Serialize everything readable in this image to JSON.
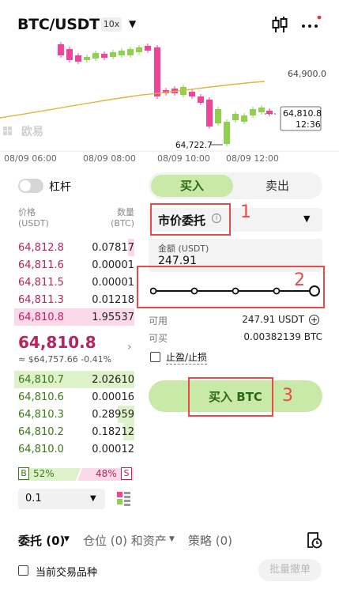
{
  "header": {
    "pair": "BTC/USDT",
    "leverage": "10x",
    "candle_icon": "candlestick-icon",
    "more_icon": "more-dots-icon"
  },
  "chart": {
    "watermark": "欧易",
    "price_labels": [
      "64,900.0",
      "64,810.8",
      "12:36"
    ],
    "low_marker": "64,722.7",
    "time_labels": [
      "08/09 06:00",
      "08/09 08:00",
      "08/09 10:00",
      "08/09 12:00"
    ],
    "colors": {
      "up": "#8fd14f",
      "down": "#f0449b",
      "ma": "#e2b53d"
    }
  },
  "trade": {
    "tab_buy": "买入",
    "tab_sell": "卖出",
    "order_type": "市价委托",
    "info_icon": "i",
    "amount_label": "金额 (USDT)",
    "amount_value": "247.91",
    "slider_percent": 100,
    "available_label": "可用",
    "available_value": "247.91 USDT",
    "canbuy_label": "可买",
    "canbuy_value": "0.00382139 BTC",
    "tpsl_label": "止盈/止损",
    "buy_button": "买入 BTC"
  },
  "orderbook": {
    "leverage_label": "杠杆",
    "price_header": "价格\n(USDT)",
    "qty_header": "数量\n(BTC)",
    "asks": [
      {
        "price": "64,812.8",
        "qty": "0.07817",
        "depth": 0.05
      },
      {
        "price": "64,811.6",
        "qty": "0.00001",
        "depth": 0.0
      },
      {
        "price": "64,811.5",
        "qty": "0.00001",
        "depth": 0.0
      },
      {
        "price": "64,811.3",
        "qty": "0.01218",
        "depth": 0.0
      },
      {
        "price": "64,810.8",
        "qty": "1.95537",
        "depth": 1.0
      }
    ],
    "last_price": "64,810.8",
    "last_sub": "≈ $64,757.66  -0.41%",
    "bids": [
      {
        "price": "64,810.7",
        "qty": "2.02610",
        "depth": 1.0
      },
      {
        "price": "64,810.6",
        "qty": "0.00016",
        "depth": 0.0
      },
      {
        "price": "64,810.3",
        "qty": "0.28959",
        "depth": 0.14
      },
      {
        "price": "64,810.2",
        "qty": "0.18212",
        "depth": 0.09
      },
      {
        "price": "64,810.0",
        "qty": "0.00012",
        "depth": 0.0
      }
    ],
    "buy_tag": "B",
    "buy_pct": "52%",
    "sell_pct": "48%",
    "sell_tag": "S",
    "buy_ratio": 0.52,
    "depth_value": "0.1"
  },
  "annotations": [
    "1",
    "2",
    "3"
  ],
  "bottom": {
    "tab_orders": "委托 (0)",
    "tab_positions": "仓位 (0) 和资产",
    "tab_strategy": "策略 (0)",
    "current_pair": "当前交易品种",
    "batch_cancel": "批量撤单"
  }
}
